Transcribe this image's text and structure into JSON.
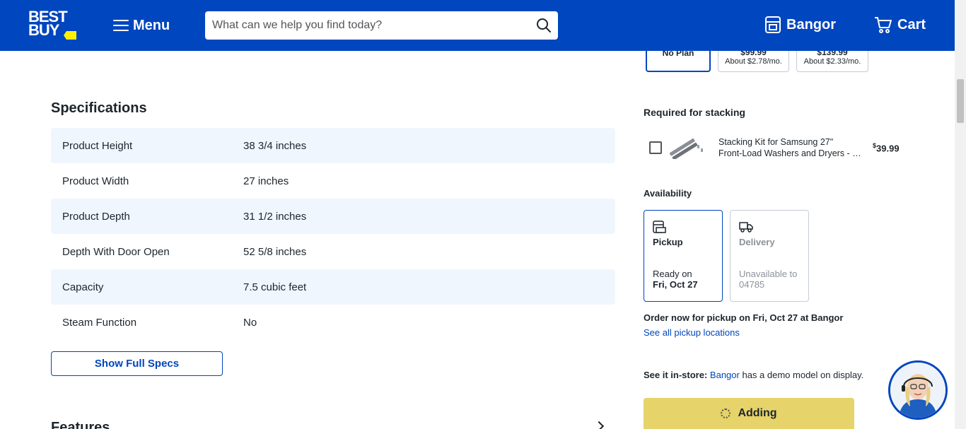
{
  "header": {
    "logo_text": "BEST BUY",
    "menu_label": "Menu",
    "search_placeholder": "What can we help you find today?",
    "store_label": "Bangor",
    "cart_label": "Cart",
    "brand_color": "#0046be",
    "tag_color": "#fff200"
  },
  "plans": [
    {
      "name": "No Plan",
      "selected": true
    },
    {
      "price": "$99.99",
      "monthly": "About $2.78/mo."
    },
    {
      "price": "$139.99",
      "monthly": "About $2.33/mo."
    }
  ],
  "specifications": {
    "title": "Specifications",
    "rows": [
      {
        "key": "Product Height",
        "value": "38 3/4 inches"
      },
      {
        "key": "Product Width",
        "value": "27 inches"
      },
      {
        "key": "Product Depth",
        "value": "31 1/2 inches"
      },
      {
        "key": "Depth With Door Open",
        "value": "52 5/8 inches"
      },
      {
        "key": "Capacity",
        "value": "7.5 cubic feet"
      },
      {
        "key": "Steam Function",
        "value": "No"
      }
    ],
    "show_full_label": "Show Full Specs"
  },
  "features_title": "Features",
  "stacking": {
    "title": "Required for stacking",
    "item_line1": "Stacking Kit for Samsung 27\"",
    "item_line2": "Front-Load Washers and Dryers - Silver",
    "price_symbol": "$",
    "price": "39.99",
    "checked": false
  },
  "availability": {
    "title": "Availability",
    "pickup": {
      "label": "Pickup",
      "line1": "Ready on",
      "line2": "Fri, Oct 27"
    },
    "delivery": {
      "label": "Delivery",
      "line1": "Unavailable to",
      "line2": "04785"
    },
    "order_now": "Order now for pickup on Fri, Oct 27 at Bangor",
    "see_all": "See all pickup locations"
  },
  "instore": {
    "prefix": "See it in-store:",
    "store_link": "Bangor",
    "suffix": "has a demo model on display."
  },
  "add_button_label": "Adding"
}
